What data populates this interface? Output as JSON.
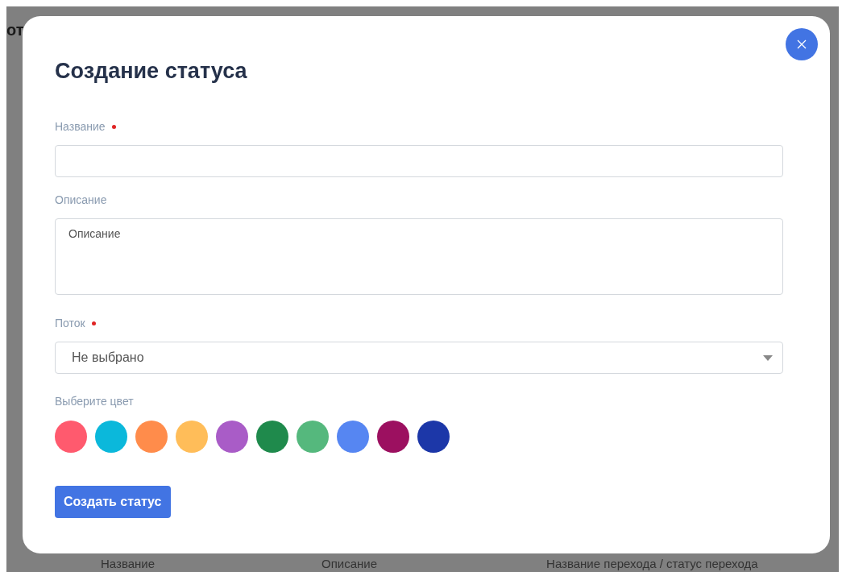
{
  "background": {
    "title": "от",
    "columns": [
      "Название",
      "Описание",
      "Название перехода / статус перехода"
    ]
  },
  "dialog": {
    "title": "Создание статуса",
    "fields": [
      {
        "kind": "input",
        "label": "Название",
        "required": true
      },
      {
        "kind": "textarea",
        "label": "Описание",
        "required": false,
        "placeholder": "Описание"
      },
      {
        "kind": "select",
        "label": "Поток",
        "required": true,
        "value": "Не выбрано"
      }
    ],
    "color_label": "Выберите цвет",
    "colors": [
      {
        "color": "#ff5a6e"
      },
      {
        "color": "#0bb8db"
      },
      {
        "color": "#ff8c4b"
      },
      {
        "color": "#ffbd59"
      },
      {
        "color": "#a95cc7"
      },
      {
        "color": "#1f8a4c"
      },
      {
        "color": "#55b87d"
      },
      {
        "color": "#5686f2"
      },
      {
        "color": "#9c1060"
      },
      {
        "color": "#1c37a8"
      }
    ],
    "submit": "Создать статус"
  }
}
